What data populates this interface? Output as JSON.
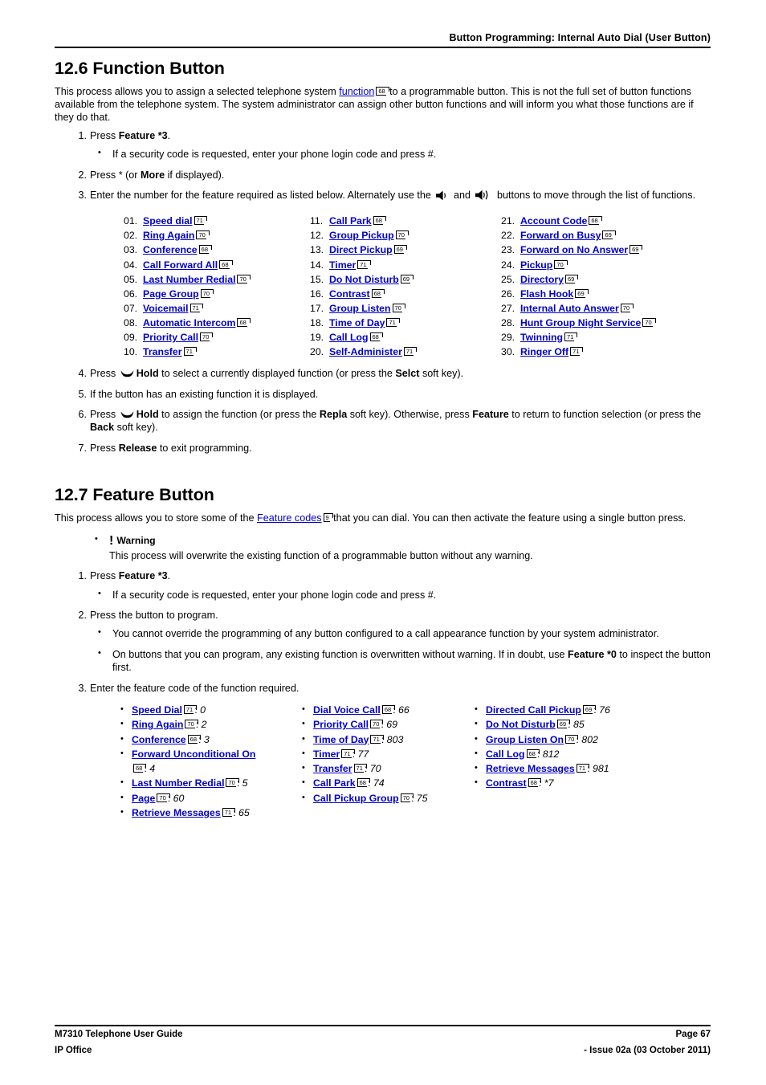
{
  "header": {
    "title": "Button Programming: Internal Auto Dial (User Button)"
  },
  "footer": {
    "left_line1": "M7310 Telephone User Guide",
    "left_line2": "IP Office",
    "right_line1": "Page 67",
    "right_line2": "- Issue 02a (03 October 2011)"
  },
  "colors": {
    "link": "#0000CC",
    "text": "#000000",
    "rule": "#000000"
  },
  "section_function": {
    "heading": "12.6 Function Button",
    "intro_a": "This process allows you to assign a selected telephone system ",
    "intro_link": "function",
    "intro_ref": "68",
    "intro_b": " to a programmable button. This is not the full set of button functions available from the telephone system. The system administrator can assign other button functions and will inform you what those functions are if they do that.",
    "steps": [
      {
        "num": "1.",
        "text_a": "Press ",
        "bold": "Feature *3",
        "text_b": ".",
        "sub": [
          "If a security code is requested, enter your phone login code and press #."
        ]
      },
      {
        "num": "2.",
        "text_a": "Press * (or ",
        "bold": "More",
        "text_b": " if displayed)."
      },
      {
        "num": "3.",
        "text_a": "Enter the number for the feature required as listed below. Alternately use the ",
        "icon1": "speaker-down-icon",
        "mid": " and ",
        "icon2": "speaker-up-icon",
        "text_b": " buttons to move through the list of functions."
      }
    ],
    "functions": [
      {
        "index": "01.",
        "label": "Speed dial",
        "ref": "71"
      },
      {
        "index": "02.",
        "label": "Ring Again",
        "ref": "70"
      },
      {
        "index": "03.",
        "label": "Conference",
        "ref": "68"
      },
      {
        "index": "04.",
        "label": "Call Forward All",
        "ref": "68"
      },
      {
        "index": "05.",
        "label": "Last Number Redial",
        "ref": "70"
      },
      {
        "index": "06.",
        "label": "Page Group",
        "ref": "70"
      },
      {
        "index": "07.",
        "label": "Voicemail",
        "ref": "71"
      },
      {
        "index": "08.",
        "label": "Automatic Intercom",
        "ref": "68"
      },
      {
        "index": "09.",
        "label": "Priority Call",
        "ref": "70"
      },
      {
        "index": "10.",
        "label": "Transfer",
        "ref": "71"
      },
      {
        "index": "11.",
        "label": "Call Park",
        "ref": "68"
      },
      {
        "index": "12.",
        "label": "Group Pickup",
        "ref": "70"
      },
      {
        "index": "13.",
        "label": "Direct Pickup",
        "ref": "69"
      },
      {
        "index": "14.",
        "label": "Timer",
        "ref": "71"
      },
      {
        "index": "15.",
        "label": "Do Not Disturb",
        "ref": "69"
      },
      {
        "index": "16.",
        "label": "Contrast",
        "ref": "68"
      },
      {
        "index": "17.",
        "label": "Group Listen",
        "ref": "70"
      },
      {
        "index": "18.",
        "label": "Time of Day",
        "ref": "71"
      },
      {
        "index": "19.",
        "label": "Call Log",
        "ref": "68"
      },
      {
        "index": "20.",
        "label": "Self-Administer",
        "ref": "71"
      },
      {
        "index": "21.",
        "label": "Account Code",
        "ref": "68"
      },
      {
        "index": "22.",
        "label": "Forward on Busy",
        "ref": "69"
      },
      {
        "index": "23.",
        "label": "Forward on No Answer",
        "ref": "69"
      },
      {
        "index": "24.",
        "label": "Pickup",
        "ref": "70"
      },
      {
        "index": "25.",
        "label": "Directory",
        "ref": "69"
      },
      {
        "index": "26.",
        "label": "Flash Hook",
        "ref": "69"
      },
      {
        "index": "27.",
        "label": "Internal Auto Answer",
        "ref": "70"
      },
      {
        "index": "28.",
        "label": "Hunt Group Night Service",
        "ref": "70"
      },
      {
        "index": "29.",
        "label": "Twinning",
        "ref": "71"
      },
      {
        "index": "30.",
        "label": "Ringer Off",
        "ref": "71"
      }
    ],
    "steps_after": [
      {
        "num": "4.",
        "pre": "Press ",
        "icon": "hold-icon",
        "bold1": "Hold",
        "mid1": " to select a currently displayed function (or press the ",
        "bold2": "Selct",
        "post": " soft key)."
      },
      {
        "num": "5.",
        "plain": "If the button has an existing function it is displayed."
      },
      {
        "num": "6.",
        "pre": "Press ",
        "icon": "hold-icon",
        "bold1": "Hold",
        "mid1": " to assign the function (or press the ",
        "bold2": "Repla",
        "mid2": " soft key). Otherwise, press ",
        "bold3": "Feature",
        "mid3": " to return to function selection (or press the ",
        "bold4": "Back",
        "post": " soft key)."
      },
      {
        "num": "7.",
        "pre": "Press ",
        "bold1": "Release",
        "post": " to exit programming."
      }
    ]
  },
  "section_feature": {
    "heading": "12.7 Feature Button",
    "intro_a": "This process allows you to store some of the ",
    "intro_link": "Feature codes",
    "intro_ref": "9",
    "intro_b": " that you can dial. You can then activate the feature using a single button press.",
    "warning": {
      "bang": "!",
      "title": "Warning",
      "body": "This process will overwrite the existing function of a programmable button without any warning."
    },
    "steps": [
      {
        "num": "1.",
        "text_a": "Press ",
        "bold": "Feature *3",
        "text_b": ".",
        "sub": [
          "If a security code is requested, enter your phone login code and press #."
        ]
      },
      {
        "num": "2.",
        "plain": "Press the button to program.",
        "sub1": "You cannot override the programming of any button configured to a call appearance function by your system administrator.",
        "sub2_a": "On buttons that you can program, any existing function is overwritten without warning. If in doubt, use ",
        "sub2_bold": "Feature *0",
        "sub2_b": " to inspect the button first."
      },
      {
        "num": "3.",
        "plain": "Enter the feature code of the function required."
      }
    ],
    "codes_col1": [
      {
        "label": "Speed Dial",
        "ref": "71",
        "code": "0"
      },
      {
        "label": "Ring Again",
        "ref": "70",
        "code": "2"
      },
      {
        "label": "Conference",
        "ref": "68",
        "code": "3"
      },
      {
        "label": "Forward Unconditional On",
        "ref": "68",
        "code": "4",
        "wrap": true
      },
      {
        "label": "Last Number Redial",
        "ref": "70",
        "code": "5"
      },
      {
        "label": "Page",
        "ref": "70",
        "code": "60"
      },
      {
        "label": "Retrieve Messages",
        "ref": "71",
        "code": "65"
      }
    ],
    "codes_col2": [
      {
        "label": "Dial Voice Call",
        "ref": "68",
        "code": "66"
      },
      {
        "label": "Priority Call",
        "ref": "70",
        "code": "69"
      },
      {
        "label": "Time of Day",
        "ref": "71",
        "code": "803"
      },
      {
        "label": "Timer",
        "ref": "71",
        "code": "77"
      },
      {
        "label": "Transfer",
        "ref": "71",
        "code": "70"
      },
      {
        "label": "Call Park",
        "ref": "68",
        "code": "74"
      },
      {
        "label": "Call Pickup Group",
        "ref": "70",
        "code": "75"
      }
    ],
    "codes_col3": [
      {
        "label": "Directed Call Pickup",
        "ref": "69",
        "code": "76"
      },
      {
        "label": "Do Not Disturb",
        "ref": "69",
        "code": "85"
      },
      {
        "label": "Group Listen On",
        "ref": "70",
        "code": "802"
      },
      {
        "label": "Call Log",
        "ref": "68",
        "code": "812"
      },
      {
        "label": "Retrieve Messages",
        "ref": "71",
        "code": "981"
      },
      {
        "label": "Contrast",
        "ref": "68",
        "code": "*7"
      }
    ]
  }
}
